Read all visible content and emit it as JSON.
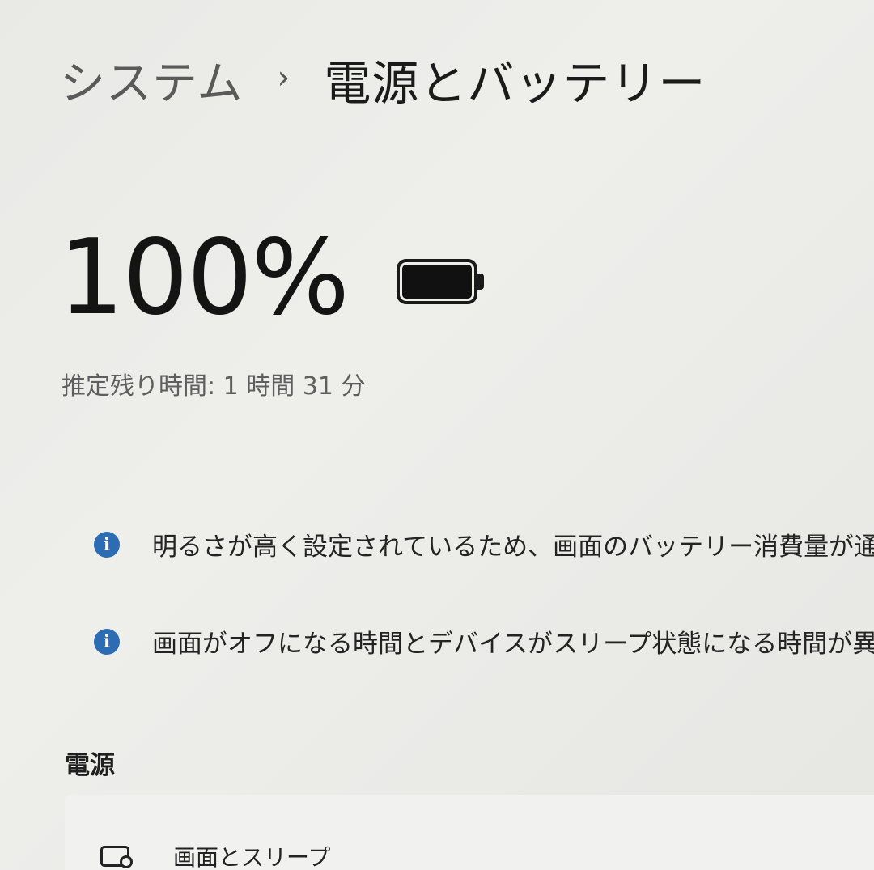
{
  "breadcrumb": {
    "parent": "システム",
    "separator": "›",
    "current": "電源とバッテリー"
  },
  "battery": {
    "percent_text": "100%",
    "level": 1.0,
    "remaining_text": "推定残り時間: 1 時間 31 分"
  },
  "notices": [
    {
      "icon": "info-icon",
      "text": "明るさが高く設定されているため、画面のバッテリー消費量が通常より多く"
    },
    {
      "icon": "info-icon",
      "text": "画面がオフになる時間とデバイスがスリープ状態になる時間が異なるため、"
    }
  ],
  "power_section": {
    "title": "電源",
    "items": [
      {
        "icon": "screen-sleep-icon",
        "label": "画面とスリープ"
      }
    ]
  },
  "colors": {
    "info_accent": "#2b6cb3",
    "background": "#ececea"
  }
}
